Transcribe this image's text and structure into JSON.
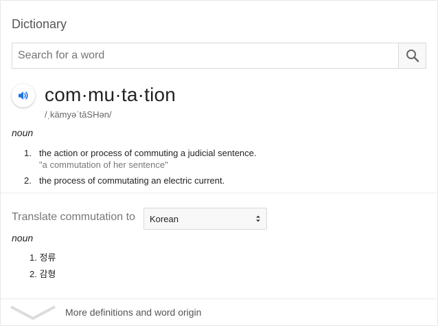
{
  "dictionary": {
    "title": "Dictionary",
    "search": {
      "placeholder": "Search for a word",
      "icon": "search-icon"
    },
    "entry": {
      "word": "com·mu·ta·tion",
      "phonetic": "/ˌkämyəˈtāSHən/",
      "part_of_speech": "noun",
      "definitions": [
        {
          "number": "1.",
          "text": "the action or process of commuting a judicial sentence.",
          "example": "\"a commutation of her sentence\""
        },
        {
          "number": "2.",
          "text": "the process of commutating an electric current.",
          "example": ""
        }
      ]
    }
  },
  "translate": {
    "label": "Translate commutation to",
    "language": "Korean",
    "part_of_speech": "noun",
    "items": [
      {
        "number": "1.",
        "text": "정류"
      },
      {
        "number": "2.",
        "text": "감형"
      }
    ]
  },
  "footer": {
    "more_label": "More definitions and word origin"
  },
  "colors": {
    "accent": "#1a73e8",
    "border": "#d9d9d9",
    "muted": "#777777"
  }
}
